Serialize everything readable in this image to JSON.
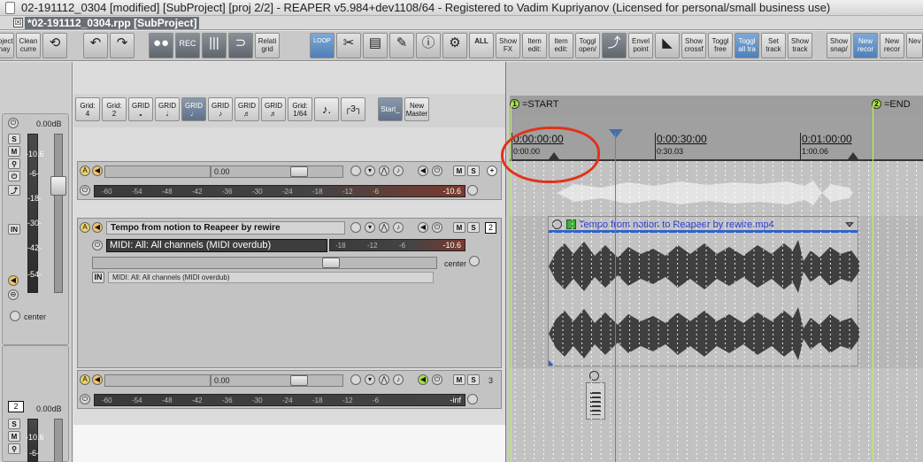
{
  "window": {
    "title": "02-191112_0304 [modified] [SubProject] [proj 2/2] - REAPER v5.984+dev1108/64 - Registered to Vadim Kupriyanov (Licensed for personal/small business use)",
    "tab_label": "*02-191112_0304.rpp [SubProject]",
    "tab_close": "☒"
  },
  "toolbar": {
    "buttons": [
      {
        "label": "roject\nnay"
      },
      {
        "label": "Clean\ncurre"
      },
      {
        "label": "⟲"
      },
      {
        "label": "↶"
      },
      {
        "label": "↷"
      },
      {
        "label": "●●"
      },
      {
        "label": "REC"
      },
      {
        "label": "|||"
      },
      {
        "label": "⊃"
      },
      {
        "label": "Relati\ngrid"
      },
      {
        "label": "LOOP"
      },
      {
        "label": "✂"
      },
      {
        "label": "▤"
      },
      {
        "label": "✎"
      },
      {
        "label": "ⓘ"
      },
      {
        "label": "⚙"
      },
      {
        "label": "ALL"
      },
      {
        "label": "Show\nFX"
      },
      {
        "label": "Item\nedit:"
      },
      {
        "label": "Item\nedit:"
      },
      {
        "label": "Toggl\nopen/"
      },
      {
        "label": "⤴"
      },
      {
        "label": "Envel\npoint"
      },
      {
        "label": "◣"
      },
      {
        "label": "Show\ncrossf"
      },
      {
        "label": "Toggl\nfree"
      },
      {
        "label": "Toggl\nall tra"
      },
      {
        "label": "Set\ntrack"
      },
      {
        "label": "Show\ntrack"
      },
      {
        "label": "Show\nsnap/"
      },
      {
        "label": "New\nrecor"
      },
      {
        "label": "New\nrecor"
      },
      {
        "label": "Nev"
      }
    ]
  },
  "grid_bar": {
    "buttons": [
      "Grid:\n4",
      "Grid:\n2",
      "GRID\n𝅝",
      "GRID\n𝅗𝅥",
      "GRID\n♩",
      "GRID\n♪",
      "GRID\n♬",
      "GRID\n♬",
      "Grid:\n1/64",
      "♪.",
      "┌3┐"
    ],
    "start_label": "Start_",
    "new_master_label": "New\nMaster"
  },
  "mixer": {
    "top_db": "0.00dB",
    "meter_labels": [
      "-10.6",
      "-6-",
      "-18-",
      "-30-",
      "-42-",
      "-54-"
    ],
    "buttons": [
      "S",
      "M",
      "⚲",
      "⏻",
      "⤴",
      "IN"
    ],
    "pan_label": "center",
    "track_number": "2",
    "bottom_db": "0.00dB",
    "bottom_meter_labels": [
      "-10.6",
      "-6-"
    ]
  },
  "tracks": [
    {
      "volume": "0.00",
      "meter_ticks": [
        "-60",
        "-54",
        "-48",
        "-42",
        "-36",
        "-30",
        "-24",
        "-18",
        "-12",
        "-6"
      ],
      "meter_value": "-10.6"
    },
    {
      "name": "Tempo from notion to Reapeer by rewire",
      "number": "2",
      "input": "MIDI: All: All channels (MIDI overdub)",
      "meter_ticks": [
        "-18",
        "-12",
        "-6"
      ],
      "meter_value": "-10.6",
      "pan": "center",
      "fx_label": "MIDI: All: All channels (MIDI overdub)",
      "in_label": "IN"
    },
    {
      "volume": "0.00",
      "number": "3",
      "meter_ticks": [
        "-60",
        "-54",
        "-48",
        "-42",
        "-36",
        "-30",
        "-24",
        "-18",
        "-12",
        "-6"
      ],
      "meter_value": "-inf"
    }
  ],
  "ruler": {
    "start_marker": {
      "num": "1",
      "label": "=START"
    },
    "end_marker": {
      "num": "2",
      "label": "=END"
    },
    "time_labels": [
      {
        "tc": "0:00:00:00",
        "sub": "0:00.00"
      },
      {
        "tc": "0:00:30:00",
        "sub": "0:30.03"
      },
      {
        "tc": "0:01:00:00",
        "sub": "1:00.06"
      }
    ]
  },
  "item": {
    "name": "Tempo from notion to Reapeer by rewire.mp4"
  },
  "colors": {
    "marker_green": "#a8e04a",
    "item_name_blue": "#2b3bd6",
    "annotation_red": "#e2321b",
    "selected_button": "#4f7fb8"
  }
}
